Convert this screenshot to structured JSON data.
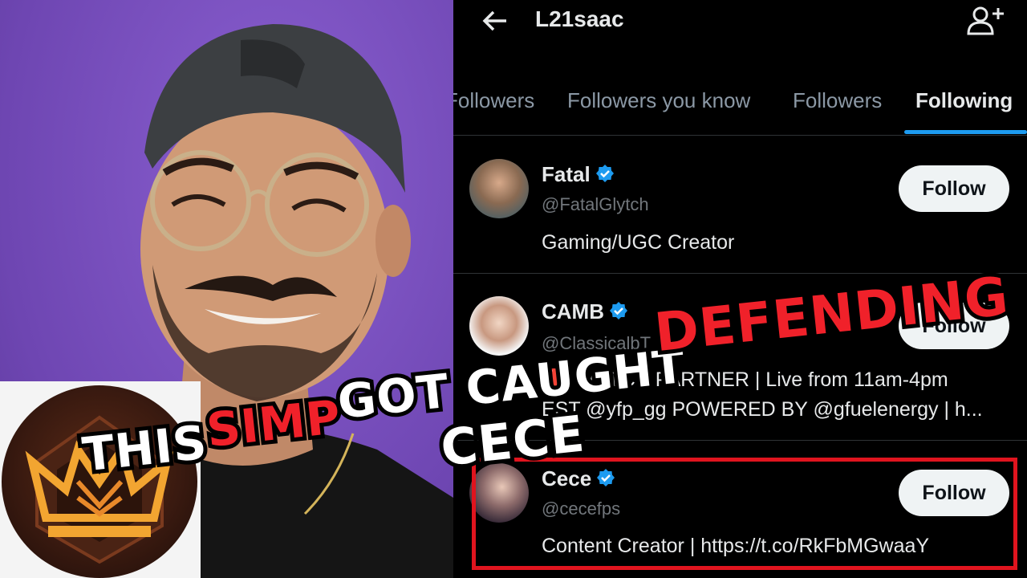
{
  "header": {
    "title": "L21saac",
    "back_icon": "arrow-left-icon",
    "add_user_icon": "add-user-icon"
  },
  "tabs": [
    {
      "label": "Followers",
      "active": false
    },
    {
      "label": "Followers you know",
      "active": false
    },
    {
      "label": "Followers",
      "active": false
    },
    {
      "label": "Following",
      "active": true
    }
  ],
  "users": [
    {
      "name": "Fatal",
      "handle": "@FatalGlytch",
      "bio": "Gaming/UGC Creator",
      "follow_label": "Follow",
      "verified": true
    },
    {
      "name": "CAMB",
      "handle": "@ClassicalbT",
      "bio_line1": "🔴 TWITCH PARTNER | Live from 11am-4pm",
      "bio_line2": "EST @yfp_gg  POWERED BY @gfuelenergy | h...",
      "follow_label": "Follow",
      "verified": true
    },
    {
      "name": "Cece",
      "handle": "@cecefps",
      "bio": "Content Creator | https://t.co/RkFbMGwaaY",
      "follow_label": "Follow",
      "verified": true
    }
  ],
  "overlay": {
    "word1": "THIS",
    "word2": "SIMP",
    "word3": "GOT CAUGHT",
    "word4": "DEFENDING",
    "word5": "CECE"
  },
  "colors": {
    "accent_blue": "#1d9bf0",
    "highlight_red": "#e0141e",
    "overlay_red": "#f0212a",
    "photo_bg": "#7a52c0"
  }
}
